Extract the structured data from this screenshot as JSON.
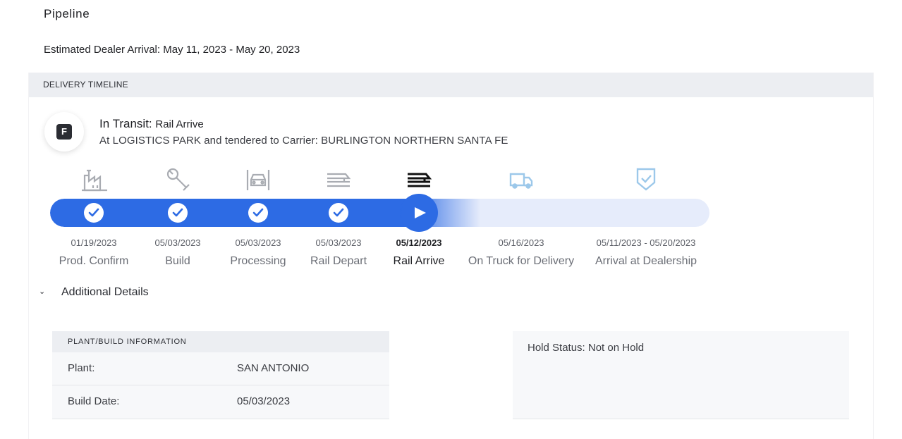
{
  "page": {
    "title": "Pipeline",
    "estimated_arrival": "Estimated Dealer Arrival: May 11, 2023 - May 20, 2023"
  },
  "timeline": {
    "header": "DELIVERY TIMELINE",
    "badge_letter": "F",
    "status_label": "In Transit:",
    "status_value": "Rail Arrive",
    "status_detail": "At LOGISTICS PARK and tendered to Carrier: BURLINGTON NORTHERN SANTA FE",
    "steps": [
      {
        "label": "Prod. Confirm",
        "date": "01/19/2023",
        "state": "complete",
        "icon": "factory-icon"
      },
      {
        "label": "Build",
        "date": "05/03/2023",
        "state": "complete",
        "icon": "wrench-icon"
      },
      {
        "label": "Processing",
        "date": "05/03/2023",
        "state": "complete",
        "icon": "car-front-icon"
      },
      {
        "label": "Rail Depart",
        "date": "05/03/2023",
        "state": "complete",
        "icon": "railcar-icon"
      },
      {
        "label": "Rail Arrive",
        "date": "05/12/2023",
        "state": "current",
        "icon": "railcar-icon"
      },
      {
        "label": "On Truck for Delivery",
        "date": "05/16/2023",
        "state": "upcoming",
        "icon": "truck-icon"
      },
      {
        "label": "Arrival at Dealership",
        "date": "05/11/2023 - 05/20/2023",
        "state": "upcoming",
        "icon": "shield-check-icon"
      }
    ],
    "colors": {
      "progress": "#2d6be4",
      "track": "#e6ecfb",
      "complete_icon": "#a9acb2",
      "current_icon": "#111111",
      "upcoming_icon": "#9cc8ea"
    }
  },
  "details": {
    "toggle_label": "Additional Details",
    "plant_card": {
      "header": "PLANT/BUILD INFORMATION",
      "rows": [
        {
          "key": "Plant:",
          "value": "SAN ANTONIO"
        },
        {
          "key": "Build Date:",
          "value": "05/03/2023"
        }
      ]
    },
    "hold_status": "Hold Status: Not on Hold"
  }
}
